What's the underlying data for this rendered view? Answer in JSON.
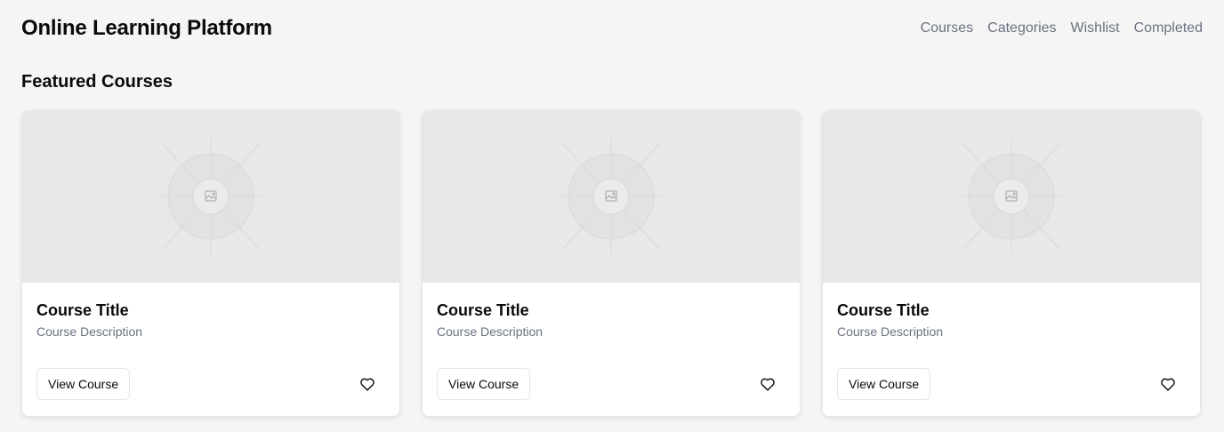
{
  "header": {
    "title": "Online Learning Platform",
    "nav": [
      {
        "label": "Courses"
      },
      {
        "label": "Categories"
      },
      {
        "label": "Wishlist"
      },
      {
        "label": "Completed"
      }
    ]
  },
  "featured": {
    "heading": "Featured Courses",
    "courses": [
      {
        "title": "Course Title",
        "description": "Course Description",
        "button": "View Course",
        "image_icon": "image-placeholder-icon",
        "wishlist_icon": "heart-icon"
      },
      {
        "title": "Course Title",
        "description": "Course Description",
        "button": "View Course",
        "image_icon": "image-placeholder-icon",
        "wishlist_icon": "heart-icon"
      },
      {
        "title": "Course Title",
        "description": "Course Description",
        "button": "View Course",
        "image_icon": "image-placeholder-icon",
        "wishlist_icon": "heart-icon"
      }
    ]
  },
  "colors": {
    "background": "#f5f5f5",
    "muted_text": "#6b7280",
    "placeholder": "#e8e8e8"
  }
}
